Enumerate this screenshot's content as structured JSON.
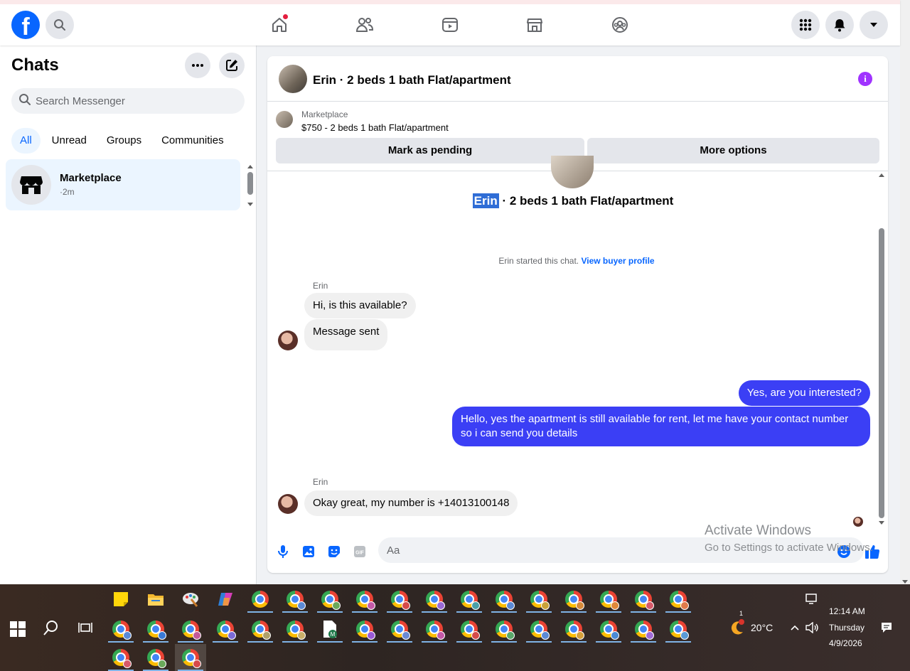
{
  "topbar": {
    "logo_letter": "f",
    "nav_icons": [
      "home-icon",
      "friends-icon",
      "video-icon",
      "marketplace-icon",
      "groups-icon"
    ],
    "right_icons": [
      "menu-grid-icon",
      "notifications-bell-icon",
      "account-caret-icon"
    ],
    "accent": "#0866ff"
  },
  "sidebar": {
    "title": "Chats",
    "search_placeholder": "Search Messenger",
    "filters": [
      "All",
      "Unread",
      "Groups",
      "Communities"
    ],
    "active_filter": "All",
    "chats": [
      {
        "name": "Marketplace",
        "time": "·2m",
        "icon": "storefront-icon"
      }
    ]
  },
  "conversation": {
    "header_title": "Erin · 2 beds 1 bath Flat/apartment",
    "listing": {
      "category": "Marketplace",
      "price_title": "$750 - 2 beds 1 bath Flat/apartment",
      "mark_pending_label": "Mark as pending",
      "more_options_label": "More options"
    },
    "big_title_name": "Erin",
    "big_title_rest": " · 2 beds 1 bath Flat/apartment",
    "system_text": "Erin started this chat.",
    "system_link": "View buyer profile",
    "messages": [
      {
        "sender": "Erin",
        "direction": "in",
        "text": "Hi, is this available?"
      },
      {
        "direction": "in",
        "text": "Message sent"
      },
      {
        "direction": "out",
        "text": "Yes, are you interested?"
      },
      {
        "direction": "out",
        "text": "Hello, yes the apartment is still available for rent, let me have your contact number so i can send you details"
      },
      {
        "sender": "Erin",
        "direction": "in",
        "text": "Okay great, my number is +14013100148"
      }
    ],
    "composer_placeholder": "Aa",
    "outgoing_color": "#3b3ff5"
  },
  "watermark": {
    "line1": "Activate Windows",
    "line2": "Go to Settings to activate Windows."
  },
  "taskbar": {
    "weather": "20°C",
    "weather_badge": "1",
    "time": "12:14 AM",
    "day": "Thursday",
    "date": "4/9/2026"
  }
}
